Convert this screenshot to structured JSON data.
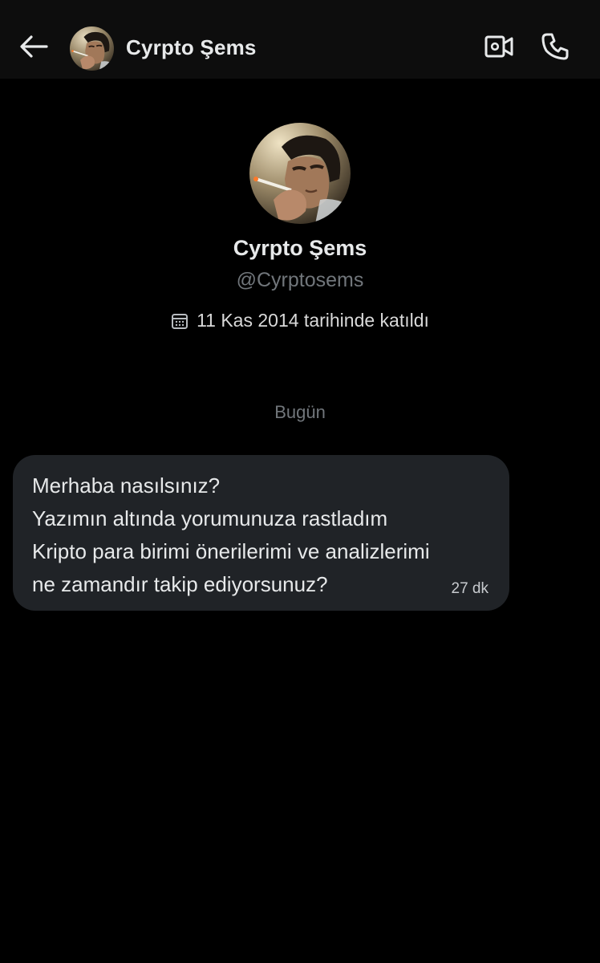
{
  "header": {
    "title": "Cyrpto Şems",
    "back_icon": "arrow-left-icon",
    "video_icon": "video-camera-icon",
    "phone_icon": "phone-icon"
  },
  "profile": {
    "name": "Cyrpto Şems",
    "handle": "@Cyrptosems",
    "joined": "11 Kas 2014 tarihinde katıldı",
    "joined_icon": "calendar-icon"
  },
  "conversation": {
    "day_separator": "Bugün",
    "messages": [
      {
        "lines": [
          "Merhaba nasılsınız?",
          "Yazımın altında yorumunuza rastladım",
          "Kripto para birimi önerilerimi ve analizlerimi",
          "ne zamandır takip ediyorsunuz?"
        ],
        "time": "27 dk"
      }
    ]
  },
  "colors": {
    "background": "#000000",
    "header": "#0d0d0d",
    "bubble": "#202327",
    "primary_text": "#e7e9ea",
    "secondary_text": "#71767b"
  }
}
